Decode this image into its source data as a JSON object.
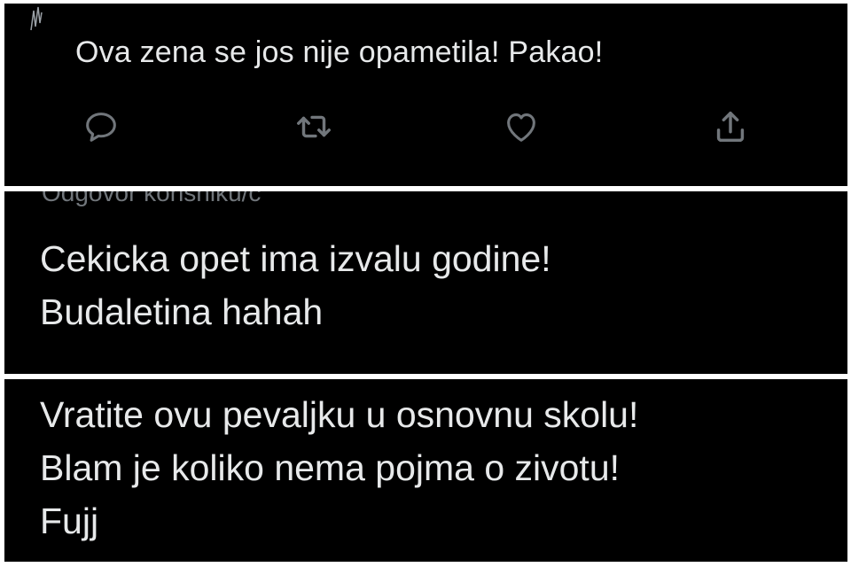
{
  "tweet": {
    "text": "Ova zena se jos nije opametila! Pakao!",
    "actions": {
      "reply_icon": "reply-icon",
      "retweet_icon": "retweet-icon",
      "like_icon": "heart-icon",
      "share_icon": "share-icon"
    }
  },
  "reply1": {
    "cut_label": "Odgovor korisniku/c",
    "lines": [
      "Cekicka opet ima izvalu godine!",
      "Budaletina hahah"
    ]
  },
  "reply2": {
    "lines": [
      "Vratite ovu pevaljku u osnovnu skolu!",
      "Blam je koliko nema pojma o zivotu!",
      "Fujj"
    ]
  },
  "colors": {
    "background": "#000000",
    "text": "#e7e9ea",
    "muted": "#71767b",
    "separator": "#ffffff"
  }
}
